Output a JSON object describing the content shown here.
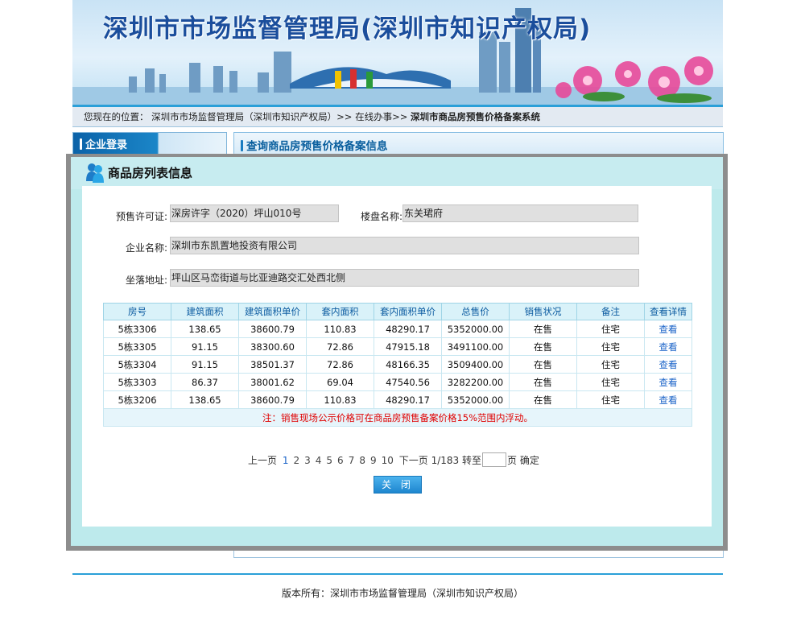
{
  "banner": {
    "title": "深圳市市场监督管理局(深圳市知识产权局)"
  },
  "breadcrumb": {
    "prefix": "您现在的位置：",
    "path": "深圳市市场监督管理局（深圳市知识产权局）>> 在线办事>>",
    "current": "深圳市商品房预售价格备案系统"
  },
  "sidebar": {
    "header": "企业登录"
  },
  "main": {
    "header": "查询商品房预售价格备案信息"
  },
  "modal": {
    "title": "商品房列表信息",
    "fields": {
      "permit_label": "预售许可证:",
      "permit_value": "深房许字（2020）坪山010号",
      "building_label": "楼盘名称:",
      "building_value": "东关珺府",
      "company_label": "企业名称:",
      "company_value": "深圳市东凯置地投资有限公司",
      "address_label": "坐落地址:",
      "address_value": "坪山区马峦街道与比亚迪路交汇处西北侧"
    },
    "table": {
      "headers": [
        "房号",
        "建筑面积",
        "建筑面积单价",
        "套内面积",
        "套内面积单价",
        "总售价",
        "销售状况",
        "备注",
        "查看详情"
      ],
      "rows": [
        [
          "5栋3306",
          "138.65",
          "38600.79",
          "110.83",
          "48290.17",
          "5352000.00",
          "在售",
          "住宅",
          "查看"
        ],
        [
          "5栋3305",
          "91.15",
          "38300.60",
          "72.86",
          "47915.18",
          "3491100.00",
          "在售",
          "住宅",
          "查看"
        ],
        [
          "5栋3304",
          "91.15",
          "38501.37",
          "72.86",
          "48166.35",
          "3509400.00",
          "在售",
          "住宅",
          "查看"
        ],
        [
          "5栋3303",
          "86.37",
          "38001.62",
          "69.04",
          "47540.56",
          "3282200.00",
          "在售",
          "住宅",
          "查看"
        ],
        [
          "5栋3206",
          "138.65",
          "38600.79",
          "110.83",
          "48290.17",
          "5352000.00",
          "在售",
          "住宅",
          "查看"
        ]
      ],
      "note": "注：销售现场公示价格可在商品房预售备案价格15%范围内浮动。"
    },
    "pager": {
      "prev": "上一页",
      "pages": [
        "1",
        "2",
        "3",
        "4",
        "5",
        "6",
        "7",
        "8",
        "9",
        "10"
      ],
      "current_page": "1",
      "next": "下一页",
      "summary": "1/183",
      "goto_label": "转至",
      "page_suffix": "页",
      "confirm": "确定"
    },
    "close_label": "关 闭"
  },
  "footer": {
    "text": "版本所有：深圳市市场监督管理局（深圳市知识产权局）"
  },
  "colors": {
    "accent": "#2a9fd8",
    "link": "#1a63c8",
    "note": "#e00000",
    "modal_bg": "#bdeaec"
  }
}
